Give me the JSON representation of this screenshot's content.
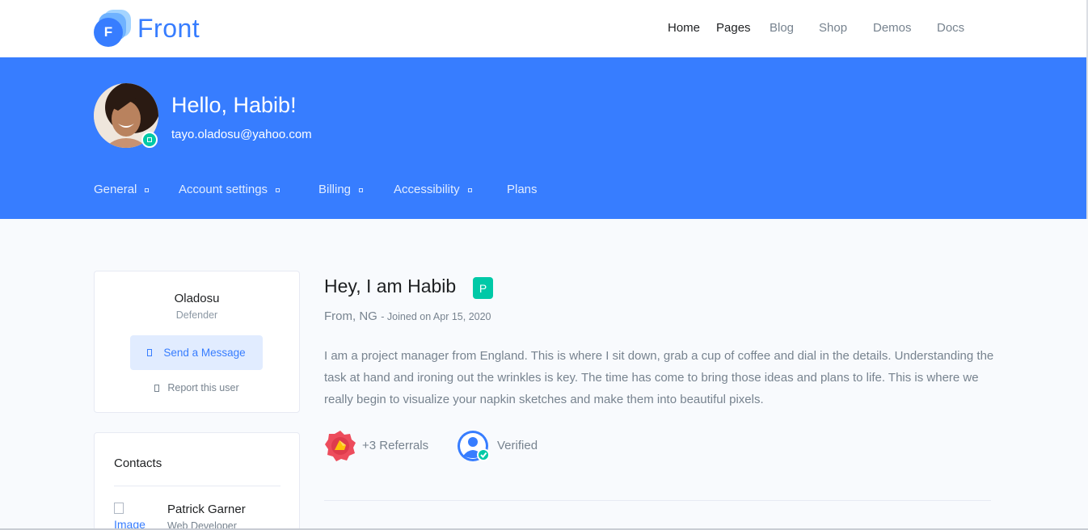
{
  "brand": {
    "name": "Front",
    "mark_letter": "F"
  },
  "nav": [
    {
      "label": "Home",
      "active": true
    },
    {
      "label": "Pages",
      "active": true
    },
    {
      "label": "Blog",
      "active": false
    },
    {
      "label": "Shop",
      "active": false
    },
    {
      "label": "Demos",
      "active": false
    },
    {
      "label": "Docs",
      "active": false
    }
  ],
  "hero": {
    "greeting": "Hello, Habib!",
    "email": "tayo.oladosu@yahoo.com",
    "status": "online"
  },
  "tabs": [
    {
      "label": "General",
      "has_dropdown": true
    },
    {
      "label": "Account settings",
      "has_dropdown": true
    },
    {
      "label": "Billing",
      "has_dropdown": true
    },
    {
      "label": "Accessibility",
      "has_dropdown": true
    },
    {
      "label": "Plans",
      "has_dropdown": false
    }
  ],
  "profile_card": {
    "name": "Oladosu",
    "role": "Defender",
    "message_button": "Send a Message",
    "report_link": "Report this user"
  },
  "contacts": {
    "title": "Contacts",
    "items": [
      {
        "image_alt": "Image",
        "name": "Patrick Garner",
        "role": "Web Developer"
      }
    ]
  },
  "main": {
    "title": "Hey, I am Habib",
    "badge": "P",
    "from": "From, NG",
    "joined": "- Joined on Apr 15, 2020",
    "bio": "I am a project manager from England. This is where I sit down, grab a cup of coffee and dial in the details. Understanding the task at hand and ironing out the wrinkles is key. The time has come to bring those ideas and plans to life. This is where we really begin to visualize your napkin sketches and make them into beautiful pixels.",
    "referrals": "+3 Referrals",
    "verified": "Verified"
  },
  "colors": {
    "primary": "#377dff",
    "success": "#00c9a7",
    "referral_badge": "#ed4c5c",
    "text_muted": "#77838f"
  }
}
